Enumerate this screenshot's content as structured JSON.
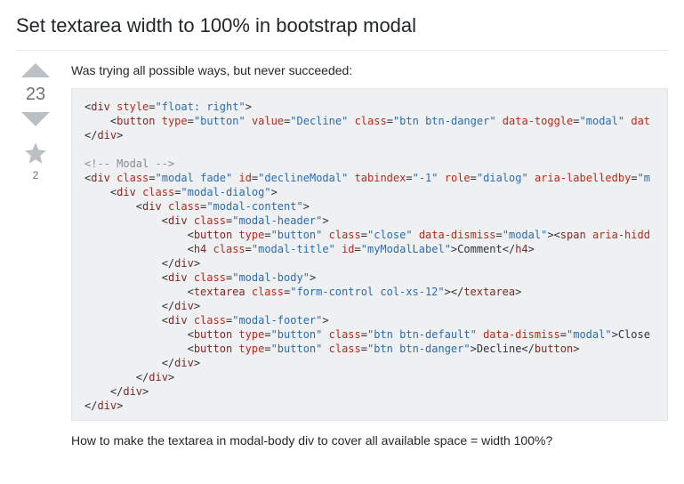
{
  "title": "Set textarea width to 100% in bootstrap modal",
  "votes": "23",
  "favorites": "2",
  "intro": "Was trying all possible ways, but never succeeded:",
  "outro": "How to make the textarea in modal-body div to cover all available space = width 100%?",
  "code": {
    "l1_tag": "div",
    "l1_attr": "style",
    "l1_val": "float: right",
    "l2_tag": "button",
    "l2_a1": "type",
    "l2_v1": "button",
    "l2_a2": "value",
    "l2_v2": "Decline",
    "l2_a3": "class",
    "l2_v3": "btn btn-danger",
    "l2_a4": "data-toggle",
    "l2_v4": "modal",
    "l2_a5": "dat",
    "l3_close": "div",
    "l5_comment": "<!-- Modal -->",
    "l6_tag": "div",
    "l6_a1": "class",
    "l6_v1": "modal fade",
    "l6_a2": "id",
    "l6_v2": "declineModal",
    "l6_a3": "tabindex",
    "l6_v3": "-1",
    "l6_a4": "role",
    "l6_v4": "dialog",
    "l6_a5": "aria-labelledby",
    "l6_v5": "m",
    "l7_tag": "div",
    "l7_a1": "class",
    "l7_v1": "modal-dialog",
    "l8_tag": "div",
    "l8_a1": "class",
    "l8_v1": "modal-content",
    "l9_tag": "div",
    "l9_a1": "class",
    "l9_v1": "modal-header",
    "l10_tag": "button",
    "l10_a1": "type",
    "l10_v1": "button",
    "l10_a2": "class",
    "l10_v2": "close",
    "l10_a3": "data-dismiss",
    "l10_v3": "modal",
    "l10_tail_tag": "span",
    "l10_tail_attr": "aria-hidd",
    "l11_tag": "h4",
    "l11_a1": "class",
    "l11_v1": "modal-title",
    "l11_a2": "id",
    "l11_v2": "myModalLabel",
    "l11_text": "Comment",
    "l11_close": "h4",
    "l12_close": "div",
    "l13_tag": "div",
    "l13_a1": "class",
    "l13_v1": "modal-body",
    "l14_tag": "textarea",
    "l14_a1": "class",
    "l14_v1": "form-control col-xs-12",
    "l14_close": "textarea",
    "l15_close": "div",
    "l16_tag": "div",
    "l16_a1": "class",
    "l16_v1": "modal-footer",
    "l17_tag": "button",
    "l17_a1": "type",
    "l17_v1": "button",
    "l17_a2": "class",
    "l17_v2": "btn btn-default",
    "l17_a3": "data-dismiss",
    "l17_v3": "modal",
    "l17_text": "Close",
    "l18_tag": "button",
    "l18_a1": "type",
    "l18_v1": "button",
    "l18_a2": "class",
    "l18_v2": "btn btn-danger",
    "l18_text": "Decline",
    "l18_close": "button",
    "l19_close": "div",
    "l20_close": "div",
    "l21_close": "div",
    "l22_close": "div"
  }
}
